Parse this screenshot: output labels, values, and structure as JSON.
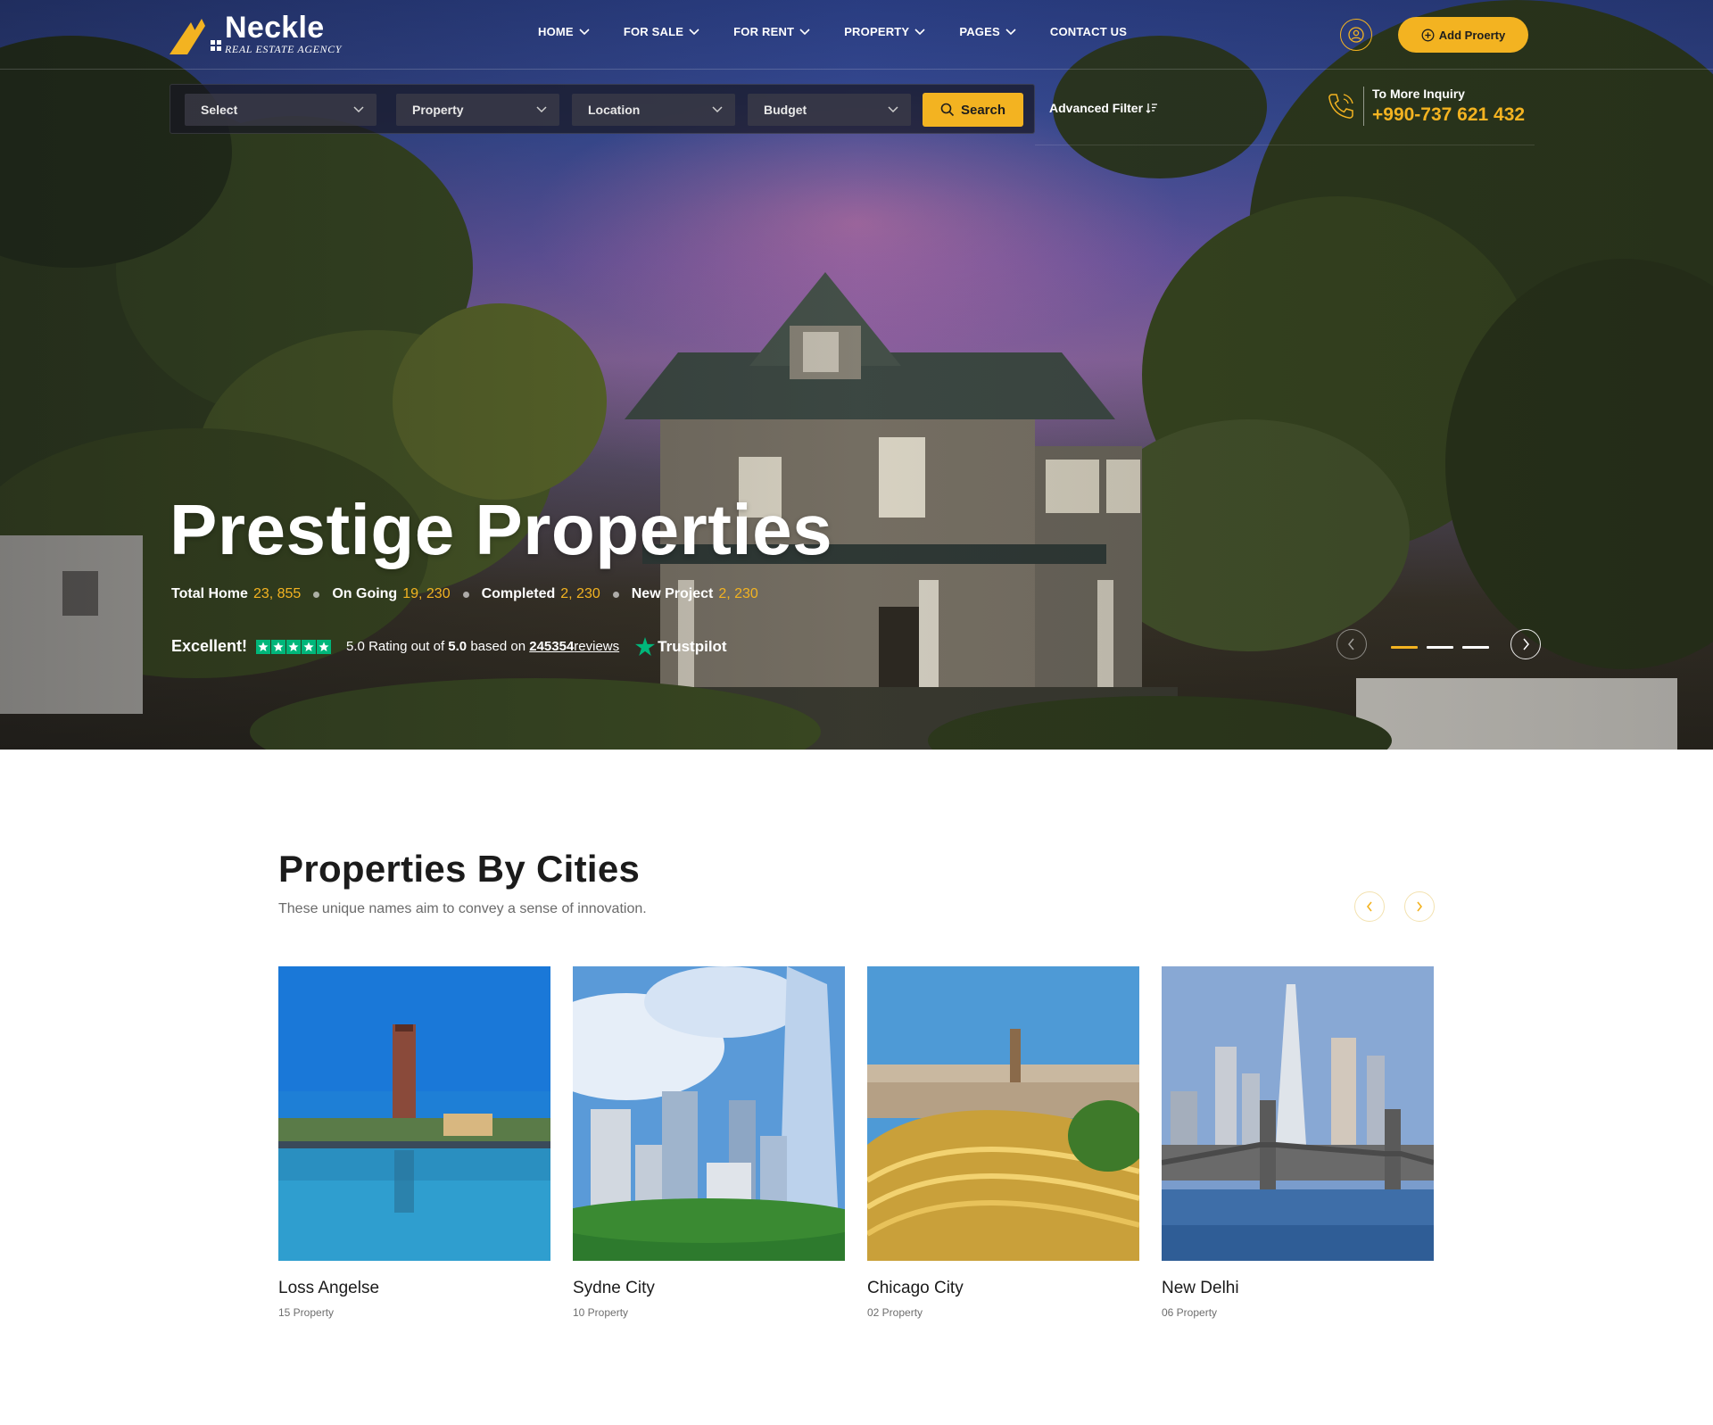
{
  "brand": {
    "name": "Neckle",
    "tagline": "REAL ESTATE AGENCY"
  },
  "nav": {
    "items": [
      {
        "label": "HOME"
      },
      {
        "label": "FOR SALE"
      },
      {
        "label": "FOR RENT"
      },
      {
        "label": "PROPERTY"
      },
      {
        "label": "PAGES"
      },
      {
        "label": "CONTACT US"
      }
    ]
  },
  "header": {
    "add_property_label": "Add Proerty"
  },
  "search": {
    "fields": [
      {
        "value": "Select"
      },
      {
        "value": "Property"
      },
      {
        "value": "Location"
      },
      {
        "value": "Budget"
      }
    ],
    "button_label": "Search",
    "advanced_label": "Advanced Filter"
  },
  "inquiry": {
    "label": "To More Inquiry",
    "phone": "+990-737 621 432"
  },
  "hero": {
    "title": "Prestige Properties",
    "stats": [
      {
        "label": "Total Home",
        "value": "23, 855"
      },
      {
        "label": "On Going",
        "value": "19, 230"
      },
      {
        "label": "Completed",
        "value": "2, 230"
      },
      {
        "label": "New Project",
        "value": "2, 230"
      }
    ],
    "rating": {
      "excellent": "Excellent!",
      "stars": 5,
      "prefix": "5.0 Rating out of",
      "max": "5.0",
      "based_on": "based on",
      "reviews_count": "245354",
      "reviews_word": "reviews",
      "provider": "Trustpilot"
    },
    "slider": {
      "active_index": 0,
      "total": 3
    }
  },
  "cities": {
    "title": "Properties By Cities",
    "subtitle": "These unique names aim to convey a sense of innovation.",
    "items": [
      {
        "name": "Loss Angelse",
        "count": "15 Property"
      },
      {
        "name": "Sydne City",
        "count": "10 Property"
      },
      {
        "name": "Chicago City",
        "count": "02 Property"
      },
      {
        "name": "New Delhi",
        "count": "06 Property"
      }
    ]
  },
  "colors": {
    "accent": "#f3b321",
    "trustpilot": "#00b67a",
    "heading": "#1b1b1b"
  }
}
